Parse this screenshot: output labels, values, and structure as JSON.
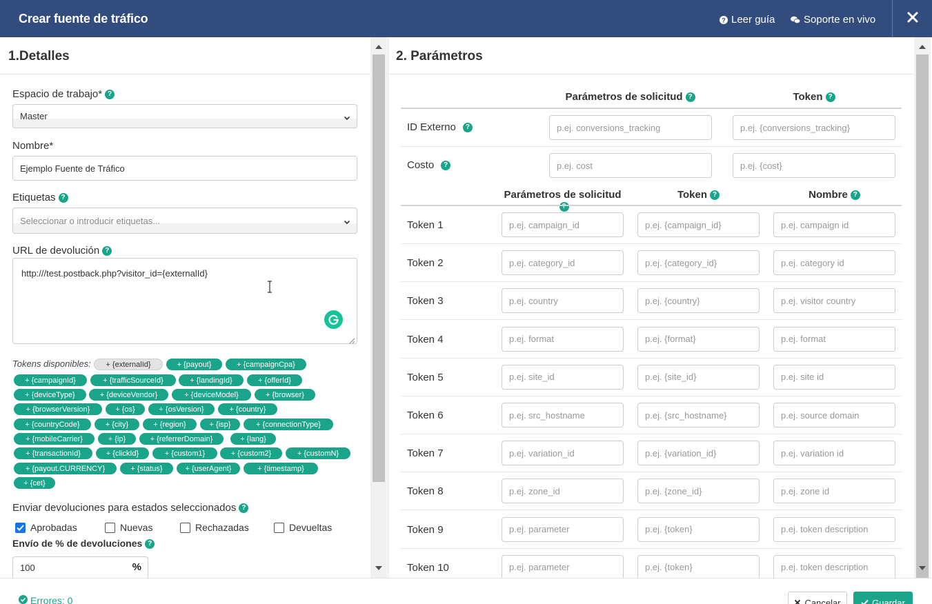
{
  "header": {
    "title": "Crear fuente de tráfico",
    "guide_link": "Leer guía",
    "support_link": "Soporte en vivo"
  },
  "details": {
    "title": "1.Detalles",
    "workspace_label": "Espacio de trabajo*",
    "workspace_value": "Master",
    "name_label": "Nombre*",
    "name_value": "Ejemplo Fuente de Tráfico",
    "tags_label": "Etiquetas",
    "tags_placeholder": "Seleccionar o introducir etiquetas...",
    "postback_label": "URL de devolución",
    "postback_value": "http:///test.postback.php?visitor_id={externalId}",
    "tokens_label": "Tokens disponibles:",
    "tokens": [
      "+ {externalId}",
      "+ {payout}",
      "+ {campaignCpa}",
      "+ {campaignId}",
      "+ {trafficSourceId}",
      "+ {landingId}",
      "+ {offerId}",
      "+ {deviceType}",
      "+ {deviceVendor}",
      "+ {deviceModel}",
      "+ {browser}",
      "+ {browserVersion}",
      "+ {os}",
      "+ {osVersion}",
      "+ {country}",
      "+ {countryCode}",
      "+ {city}",
      "+ {region}",
      "+ {isp}",
      "+ {connectionType}",
      "+ {mobileCarrier}",
      "+ {ip}",
      "+ {referrerDomain}",
      "+ {lang}",
      "+ {transactionId}",
      "+ {clickId}",
      "+ {custom1}",
      "+ {custom2}",
      "+ {customN}",
      "+ {payout.CURRENCY}",
      "+ {status}",
      "+ {userAgent}",
      "+ {timestamp}",
      "+ {cet}"
    ],
    "statuses_label": "Enviar devoluciones para estados seleccionados",
    "statuses": [
      {
        "label": "Aprobadas",
        "checked": true
      },
      {
        "label": "Nuevas",
        "checked": false
      },
      {
        "label": "Rechazadas",
        "checked": false
      },
      {
        "label": "Devueltas",
        "checked": false
      }
    ],
    "percent_label": "Envío de % de devoluciones",
    "percent_value": "100",
    "percent_unit": "%"
  },
  "params": {
    "title": "2. Parámetros",
    "col_request": "Parámetros de solicitud",
    "col_token": "Token",
    "col_name": "Nombre",
    "fixed_rows": [
      {
        "label": "ID Externo",
        "param_ph": "p.ej. conversions_tracking",
        "token_ph": "p.ej. {conversions_tracking}"
      },
      {
        "label": "Costo",
        "param_ph": "p.ej. cost",
        "token_ph": "p.ej. {cost}"
      }
    ],
    "token_rows": [
      {
        "label": "Token 1",
        "param_ph": "p.ej. campaign_id",
        "token_ph": "p.ej. {campaign_id}",
        "name_ph": "p.ej. campaign id"
      },
      {
        "label": "Token 2",
        "param_ph": "p.ej. category_id",
        "token_ph": "p.ej. {category_id}",
        "name_ph": "p.ej. category id"
      },
      {
        "label": "Token 3",
        "param_ph": "p.ej. country",
        "token_ph": "p.ej. {country}",
        "name_ph": "p.ej. visitor country"
      },
      {
        "label": "Token 4",
        "param_ph": "p.ej. format",
        "token_ph": "p.ej. {format}",
        "name_ph": "p.ej. format"
      },
      {
        "label": "Token 5",
        "param_ph": "p.ej. site_id",
        "token_ph": "p.ej. {site_id}",
        "name_ph": "p.ej. site id"
      },
      {
        "label": "Token 6",
        "param_ph": "p.ej. src_hostname",
        "token_ph": "p.ej.  {src_hostname}",
        "name_ph": "p.ej. source domain"
      },
      {
        "label": "Token 7",
        "param_ph": "p.ej. variation_id",
        "token_ph": "p.ej. {variation_id}",
        "name_ph": "p.ej. variation id"
      },
      {
        "label": "Token 8",
        "param_ph": "p.ej. zone_id",
        "token_ph": "p.ej. {zone_id}",
        "name_ph": "p.ej. zone id"
      },
      {
        "label": "Token 9",
        "param_ph": "p.ej. parameter",
        "token_ph": "p.ej. {token}",
        "name_ph": "p.ej. token description"
      },
      {
        "label": "Token 10",
        "param_ph": "p.ej. parameter",
        "token_ph": "p.ej. {token}",
        "name_ph": "p.ej. token description"
      }
    ]
  },
  "footer": {
    "errors": "Errores: 0",
    "cancel": "Cancelar",
    "save": "Guardar"
  },
  "colors": {
    "header_bg": "#324c7e",
    "accent": "#1aa58a",
    "checkbox": "#1a73e8"
  }
}
